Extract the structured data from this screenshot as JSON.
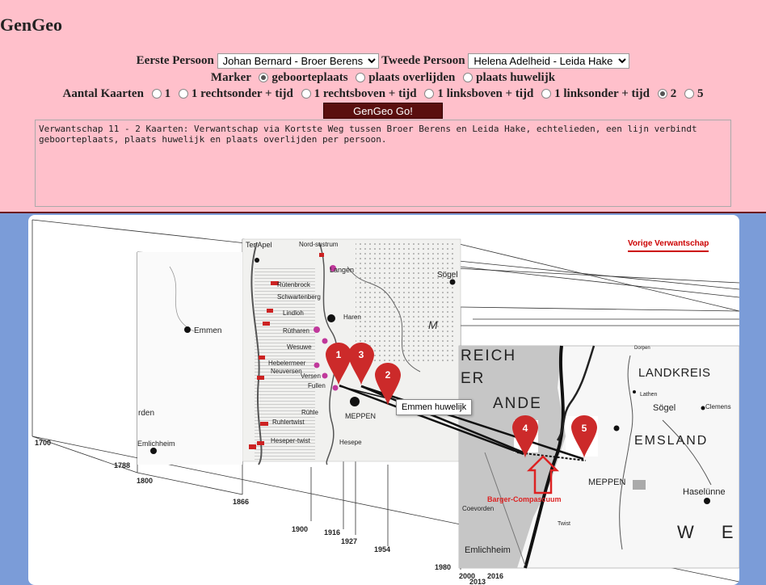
{
  "app": {
    "title": "GenGeo"
  },
  "form": {
    "person1_label": "Eerste Persoon",
    "person1_value": "Johan Bernard - Broer Berens",
    "person2_label": "Tweede Persoon",
    "person2_value": "Helena Adelheid - Leida Hake",
    "marker_label": "Marker",
    "marker_options": [
      "geboorteplaats",
      "plaats overlijden",
      "plaats huwelijk"
    ],
    "marker_selected": "geboorteplaats",
    "maps_label": "Aantal Kaarten",
    "maps_options": [
      "1",
      "1 rechtsonder + tijd",
      "1 rechtsboven + tijd",
      "1 linksboven + tijd",
      "1 linksonder + tijd",
      "2",
      "5"
    ],
    "maps_selected": "2",
    "go_label": "GenGeo Go!",
    "description": "Verwantschap 11 - 2 Kaarten: Verwantschap via Kortste Weg tussen Broer Berens en Leida Hake, echtelieden, een lijn verbindt geboorteplaats, plaats huwelijk en plaats overlijden per persoon."
  },
  "panel": {
    "prev_link": "Vorige Verwantschap",
    "tooltip": "Emmen huwelijk",
    "markers": [
      "1",
      "2",
      "3",
      "4",
      "5"
    ],
    "annotation": "Barger-Compascuum",
    "years": [
      "1700",
      "1788",
      "1800",
      "1866",
      "1900",
      "1916",
      "1927",
      "1954",
      "1980",
      "2000",
      "2013",
      "2016"
    ],
    "map1_labels": [
      "Ter Apel",
      "Emmen",
      "Langen",
      "Rütenbrock",
      "Schwartenberg",
      "Lindloh",
      "Haren",
      "Rütharen",
      "Wesuwe",
      "Versen",
      "Hebelermeer",
      "Neuversen",
      "Fullen",
      "Rühle",
      "MEPPEN",
      "Ruhlertwist",
      "Heseper-twist",
      "Hesepe",
      "Emlichheim",
      "Sögel",
      "rden",
      "Nord-sustrum"
    ],
    "map2_labels": [
      "LANDKREIS",
      "EMSLAND",
      "MEPPEN",
      "Sögel",
      "Haselünne",
      "Lathen",
      "Clemens",
      "Emlichheim",
      "Twist",
      "W E",
      "REICH",
      "ER",
      "ANDE",
      "Dorpen",
      "Coevorden"
    ]
  },
  "colors": {
    "top_bg": "#ffc0cb",
    "body_bg": "#7b9cd8",
    "button_bg": "#5a0f0f",
    "marker": "#cc2a2a",
    "link": "#cc0000"
  }
}
